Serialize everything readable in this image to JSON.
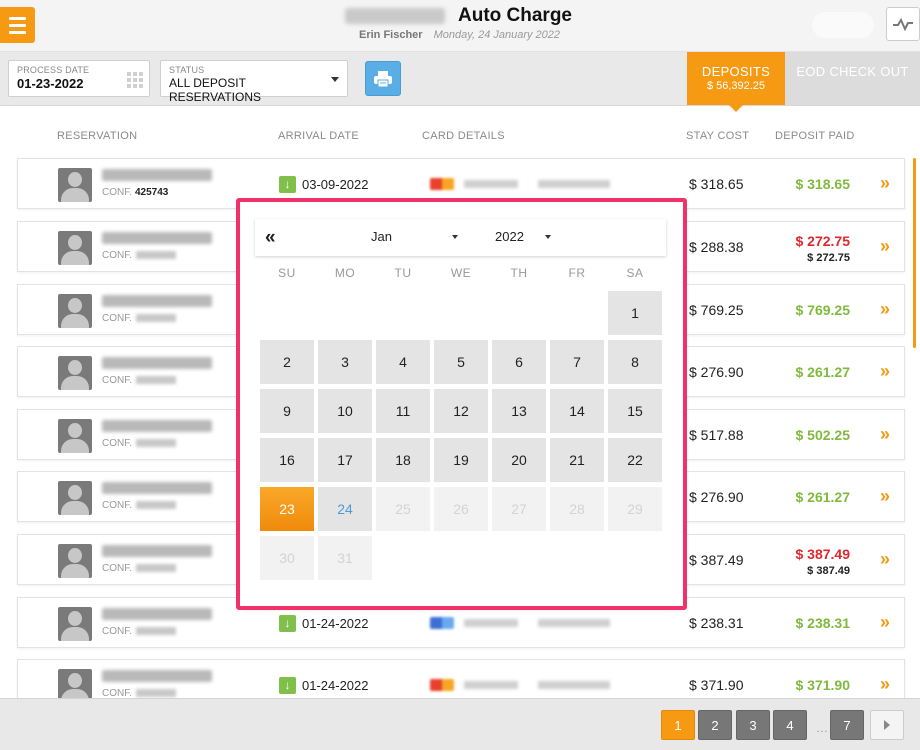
{
  "header": {
    "title": "Auto Charge",
    "user": "Erin Fischer",
    "date": "Monday, 24 January 2022"
  },
  "toolbar": {
    "process_date_label": "PROCESS DATE",
    "process_date_value": "01-23-2022",
    "status_label": "STATUS",
    "status_value": "ALL DEPOSIT RESERVATIONS",
    "tabs": {
      "deposits_label": "DEPOSITS",
      "deposits_amount": "$ 56,392.25",
      "eod_label": "EOD CHECK OUT"
    }
  },
  "table": {
    "headers": [
      "RESERVATION",
      "ARRIVAL DATE",
      "CARD DETAILS",
      "STAY COST",
      "DEPOSIT PAID"
    ],
    "conf_label": "CONF.",
    "rows": [
      {
        "conf": "425743",
        "arrival": "03-09-2022",
        "stay": "$ 318.65",
        "deposit": "$ 318.65",
        "deposit_status": "green",
        "deposit_sub": ""
      },
      {
        "conf": "",
        "arrival": "",
        "stay": "$ 288.38",
        "deposit": "$ 272.75",
        "deposit_status": "red",
        "deposit_sub": "$ 272.75"
      },
      {
        "conf": "",
        "arrival": "",
        "stay": "$ 769.25",
        "deposit": "$ 769.25",
        "deposit_status": "green",
        "deposit_sub": ""
      },
      {
        "conf": "",
        "arrival": "",
        "stay": "$ 276.90",
        "deposit": "$ 261.27",
        "deposit_status": "green",
        "deposit_sub": ""
      },
      {
        "conf": "",
        "arrival": "",
        "stay": "$ 517.88",
        "deposit": "$ 502.25",
        "deposit_status": "green",
        "deposit_sub": ""
      },
      {
        "conf": "",
        "arrival": "",
        "stay": "$ 276.90",
        "deposit": "$ 261.27",
        "deposit_status": "green",
        "deposit_sub": ""
      },
      {
        "conf": "",
        "arrival": "",
        "stay": "$ 387.49",
        "deposit": "$ 387.49",
        "deposit_status": "red",
        "deposit_sub": "$ 387.49"
      },
      {
        "conf": "",
        "arrival": "01-24-2022",
        "stay": "$ 238.31",
        "deposit": "$ 238.31",
        "deposit_status": "green",
        "deposit_sub": ""
      },
      {
        "conf": "",
        "arrival": "01-24-2022",
        "stay": "$ 371.90",
        "deposit": "$ 371.90",
        "deposit_status": "green",
        "deposit_sub": ""
      }
    ]
  },
  "datepicker": {
    "prev_icon": "«",
    "month": "Jan",
    "year": "2022",
    "weekdays": [
      "SU",
      "MO",
      "TU",
      "WE",
      "TH",
      "FR",
      "SA"
    ],
    "days": [
      {
        "label": "1",
        "state": "normal"
      },
      {
        "label": "2",
        "state": "normal"
      },
      {
        "label": "3",
        "state": "normal"
      },
      {
        "label": "4",
        "state": "normal"
      },
      {
        "label": "5",
        "state": "normal"
      },
      {
        "label": "6",
        "state": "normal"
      },
      {
        "label": "7",
        "state": "normal"
      },
      {
        "label": "8",
        "state": "normal"
      },
      {
        "label": "9",
        "state": "normal"
      },
      {
        "label": "10",
        "state": "normal"
      },
      {
        "label": "11",
        "state": "normal"
      },
      {
        "label": "12",
        "state": "normal"
      },
      {
        "label": "13",
        "state": "normal"
      },
      {
        "label": "14",
        "state": "normal"
      },
      {
        "label": "15",
        "state": "normal"
      },
      {
        "label": "16",
        "state": "normal"
      },
      {
        "label": "17",
        "state": "normal"
      },
      {
        "label": "18",
        "state": "normal"
      },
      {
        "label": "19",
        "state": "normal"
      },
      {
        "label": "20",
        "state": "normal"
      },
      {
        "label": "21",
        "state": "normal"
      },
      {
        "label": "22",
        "state": "normal"
      },
      {
        "label": "23",
        "state": "selected"
      },
      {
        "label": "24",
        "state": "today"
      },
      {
        "label": "25",
        "state": "disabled"
      },
      {
        "label": "26",
        "state": "disabled"
      },
      {
        "label": "27",
        "state": "disabled"
      },
      {
        "label": "28",
        "state": "disabled"
      },
      {
        "label": "29",
        "state": "disabled"
      },
      {
        "label": "30",
        "state": "disabled"
      },
      {
        "label": "31",
        "state": "disabled"
      }
    ]
  },
  "pagination": {
    "pages": [
      "1",
      "2",
      "3",
      "4",
      "7"
    ],
    "active": "1",
    "ellipsis": "…"
  },
  "colors": {
    "accent": "#f59a12",
    "highlight_border": "#f2316b",
    "paid_green": "#7fba3c",
    "unpaid_red": "#e0272d",
    "print_blue": "#5aaee6"
  },
  "icons": [
    "menu-icon",
    "activity-icon",
    "calendar-grid-icon",
    "dropdown-caret-icon",
    "print-icon",
    "arrival-down-icon",
    "card-logo-icon",
    "chevron-double-right-icon",
    "double-left-icon",
    "next-page-icon"
  ]
}
